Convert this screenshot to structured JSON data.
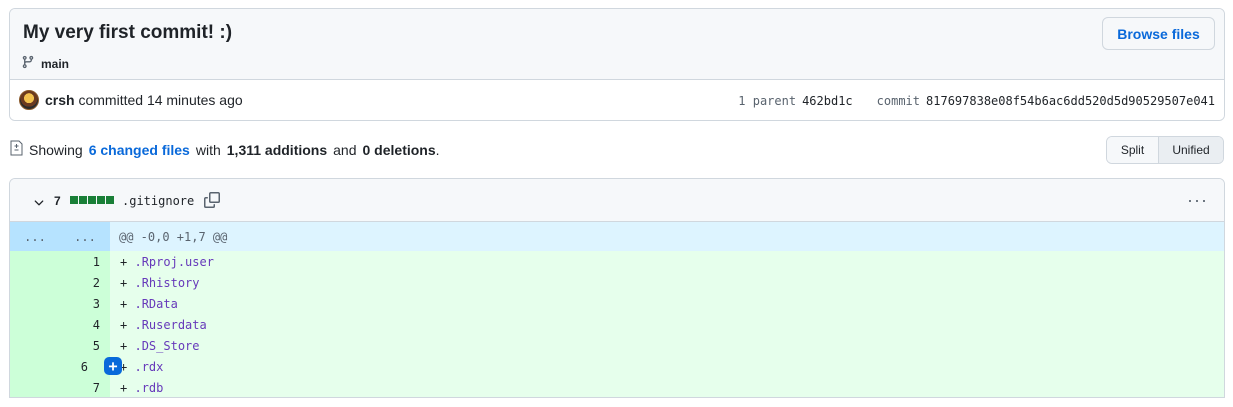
{
  "commit": {
    "title": "My very first commit! :)",
    "branch": "main",
    "browse_label": "Browse files",
    "author": "crsh",
    "action": "committed",
    "time": "14 minutes ago",
    "parent_label": "1 parent",
    "parent_hash": "462bd1c",
    "commit_label": "commit",
    "commit_hash": "817697838e08f54b6ac6dd520d5d90529507e041"
  },
  "summary": {
    "prefix": "Showing",
    "changed_files": "6 changed files",
    "with": "with",
    "additions": "1,311 additions",
    "and": "and",
    "deletions": "0 deletions",
    "suffix": "."
  },
  "view_toggle": {
    "split_label": "Split",
    "unified_label": "Unified",
    "selected": "Unified"
  },
  "file": {
    "changes": "7",
    "name": ".gitignore",
    "hunk_left": "...",
    "hunk_right": "...",
    "hunk_header": "@@ -0,0 +1,7 @@",
    "lines": [
      {
        "num": "1",
        "sign": "+",
        "text": ".Rproj.user"
      },
      {
        "num": "2",
        "sign": "+",
        "text": ".Rhistory"
      },
      {
        "num": "3",
        "sign": "+",
        "text": ".RData"
      },
      {
        "num": "4",
        "sign": "+",
        "text": ".Ruserdata"
      },
      {
        "num": "5",
        "sign": "+",
        "text": ".DS_Store"
      },
      {
        "num": "6",
        "sign": "+",
        "text": ".rdx"
      },
      {
        "num": "7",
        "sign": "+",
        "text": ".rdb"
      }
    ],
    "more_label": "···"
  },
  "colors": {
    "addition_bg": "#e6ffec",
    "addition_gutter": "#ccffd8",
    "hunk_bg": "#ddf4ff",
    "link": "#0969da",
    "diffstat_green": "#1a7f37"
  }
}
